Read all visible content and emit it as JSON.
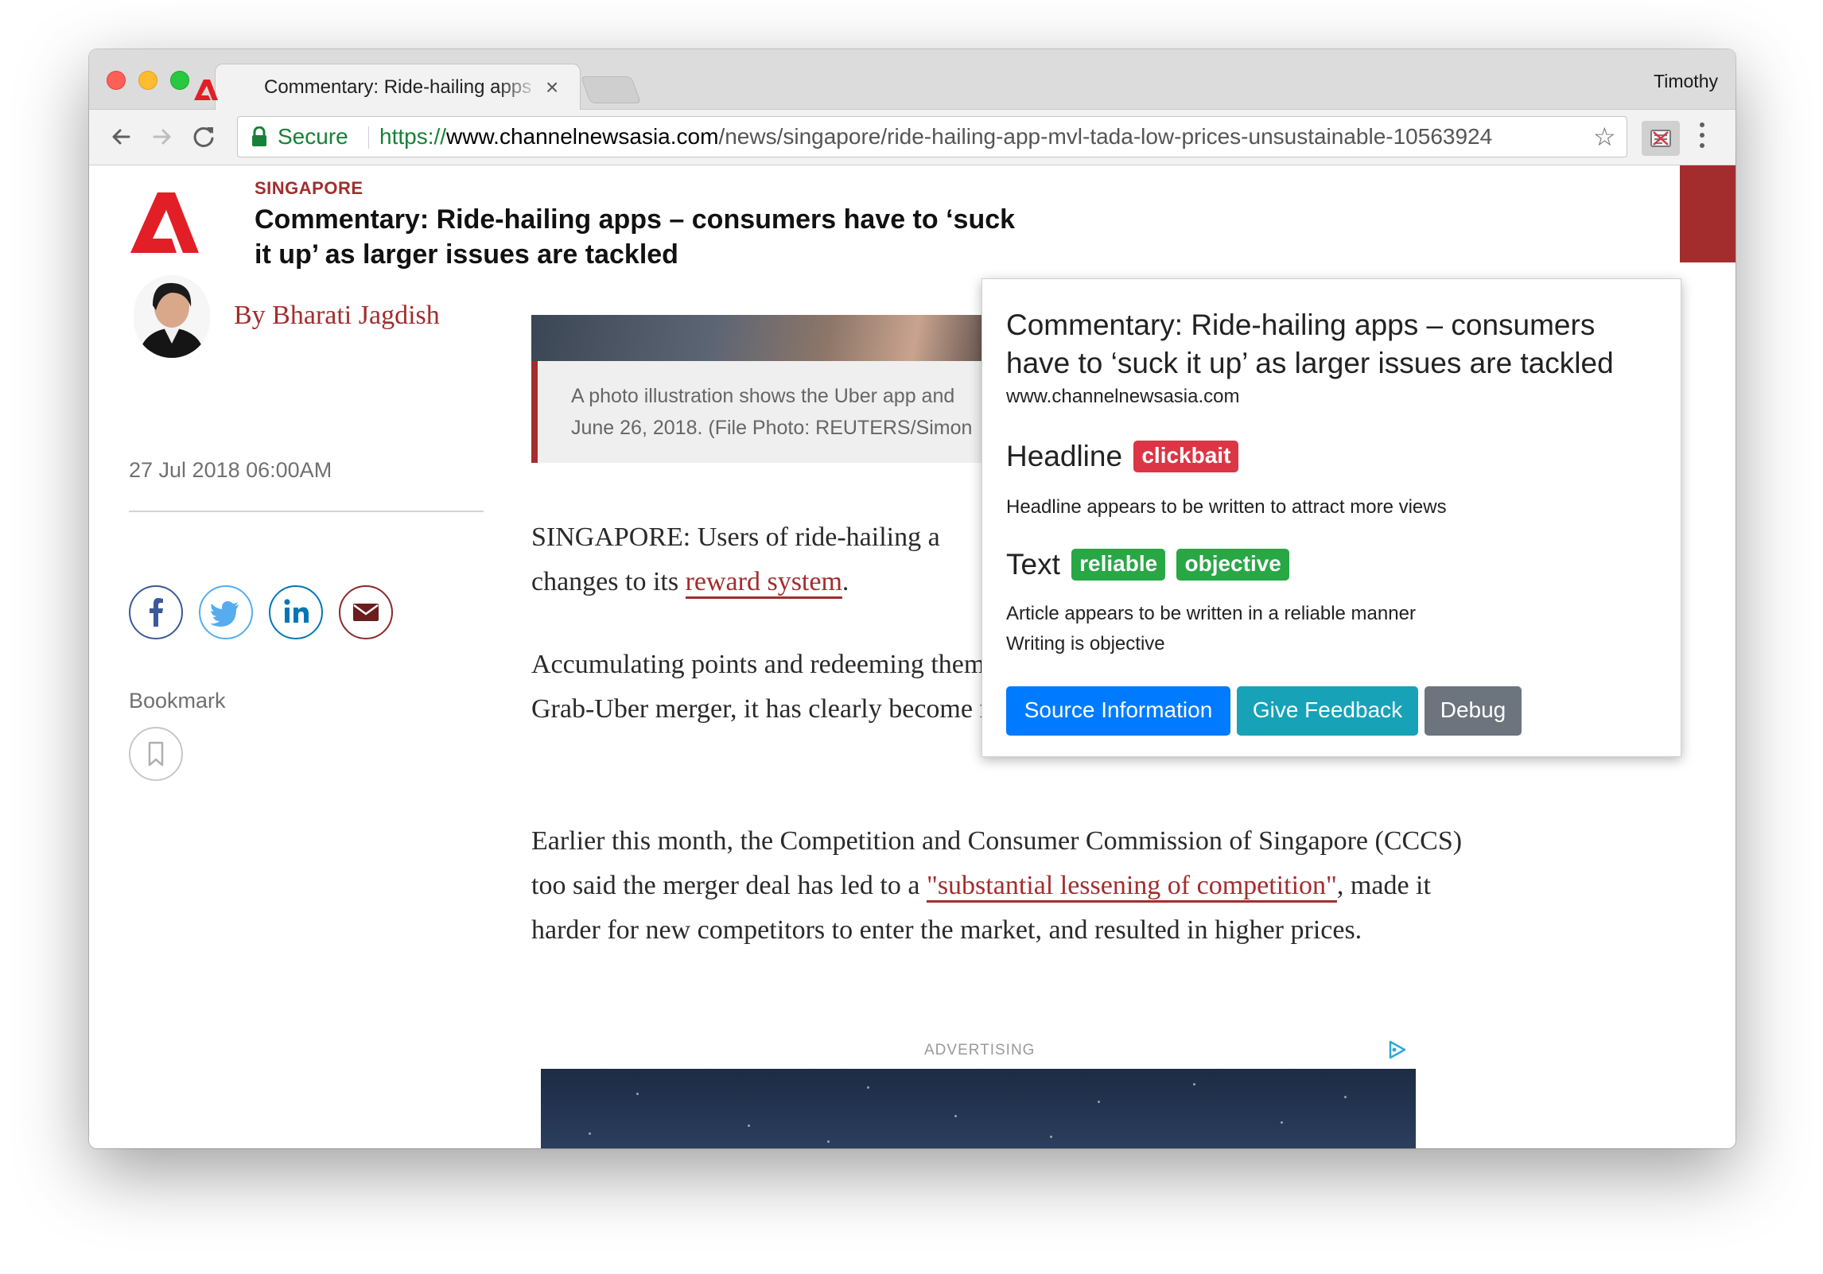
{
  "browser": {
    "tab_title": "Commentary: Ride-hailing apps – consumers have to ‘suck it up’ as larger issues are tackled",
    "tab_close": "×",
    "profile_name": "Timothy",
    "security_label": "Secure",
    "url_scheme": "https://",
    "url_host": "www.channelnewsasia.com",
    "url_path": "/news/singapore/ride-hailing-app-mvl-tada-low-prices-unsustainable-10563924",
    "bookmark_star": "☆",
    "icons": {
      "back": "arrow-left-icon",
      "forward": "arrow-right-icon",
      "reload": "reload-icon",
      "lock": "lock-icon",
      "extension": "extension-icon",
      "menu": "vertical-dots-icon"
    }
  },
  "article": {
    "category": "SINGAPORE",
    "headline": "Commentary: Ride-hailing apps – consumers have to ‘suck it up’ as larger issues are tackled",
    "author": "By Bharati Jagdish",
    "photo_caption_line1": "A photo illustration shows the Uber app and",
    "photo_caption_line2": "June 26, 2018. (File Photo: REUTERS/Simon",
    "date": "27 Jul 2018 06:00AM",
    "bookmark_label": "Bookmark",
    "share_icons": [
      "facebook-icon",
      "twitter-icon",
      "linkedin-icon",
      "email-icon"
    ],
    "paragraphs": {
      "p1_line1": "SINGAPORE: Users of ride-hailing a",
      "p1_before_link": "changes to its ",
      "p1_link": "reward system",
      "p1_after_link": ".",
      "p2_text": "Accumulating points and redeeming them for rewards has been possible, but since the Grab-Uber merger, it has clearly become more difficult to do so.",
      "p3_before_link": "Earlier this month, the Competition and Consumer Commission of Singapore (CCCS) too said the merger deal has led to a ",
      "p3_link": "\"substantial lessening of competition\"",
      "p3_after_link": ", made it harder for new competitors to enter the market, and resulted in higher prices."
    },
    "ad_label": "ADVERTISING"
  },
  "popup": {
    "title": "Commentary: Ride-hailing apps – consumers have to ‘suck it up’ as larger issues are tackled",
    "domain": "www.channelnewsasia.com",
    "headline_label": "Headline",
    "headline_badge": "clickbait",
    "headline_desc": "Headline appears to be written to attract more views",
    "text_label": "Text",
    "text_badge_1": "reliable",
    "text_badge_2": "objective",
    "text_desc_1": "Article appears to be written in a reliable manner",
    "text_desc_2": "Writing is objective",
    "btn_source": "Source Information",
    "btn_feedback": "Give Feedback",
    "btn_debug": "Debug"
  },
  "colors": {
    "brand_red": "#a32d2d",
    "secure_green": "#188038",
    "badge_red": "#dc3545",
    "badge_green": "#28a745",
    "btn_primary": "#007bff",
    "btn_info": "#17a2b8",
    "btn_secondary": "#6c757d"
  }
}
